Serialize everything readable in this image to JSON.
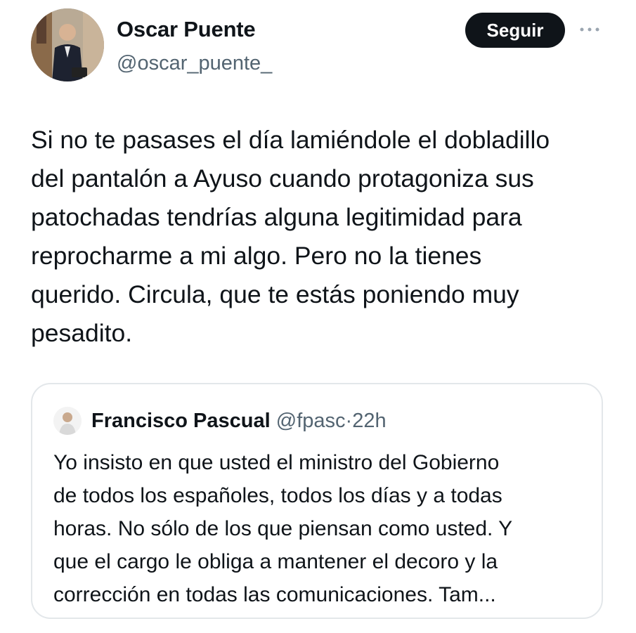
{
  "author": {
    "display_name": "Oscar Puente",
    "handle": "@oscar_puente_",
    "avatar": "profile-photo"
  },
  "follow_button": {
    "label": "Seguir"
  },
  "more_icon": "more-horizontal-icon",
  "tweet": {
    "text": "Si no te pasases el día lamiéndole el dobladillo\ndel pantalón a Ayuso cuando protagoniza sus\npatochadas tendrías alguna legitimidad para\nreprocharme a mi algo. Pero no la tienes\nquerido. Circula, que te estás poniendo muy\npesadito."
  },
  "quoted_tweet": {
    "display_name": "Francisco Pascual",
    "handle": "@fpasc",
    "separator": "·",
    "time": "22h",
    "text": "Yo insisto en que usted el ministro del Gobierno\nde todos los españoles, todos los días y a todas\nhoras. No sólo de los que piensan como usted. Y\nque el cargo le obliga a mantener el decoro y la\ncorrección en todas las comunicaciones. Tam..."
  },
  "colors": {
    "text_primary": "#0f1419",
    "text_secondary": "#536471",
    "button_bg": "#0f1419",
    "button_text": "#ffffff",
    "card_border": "#e3e7ea"
  }
}
